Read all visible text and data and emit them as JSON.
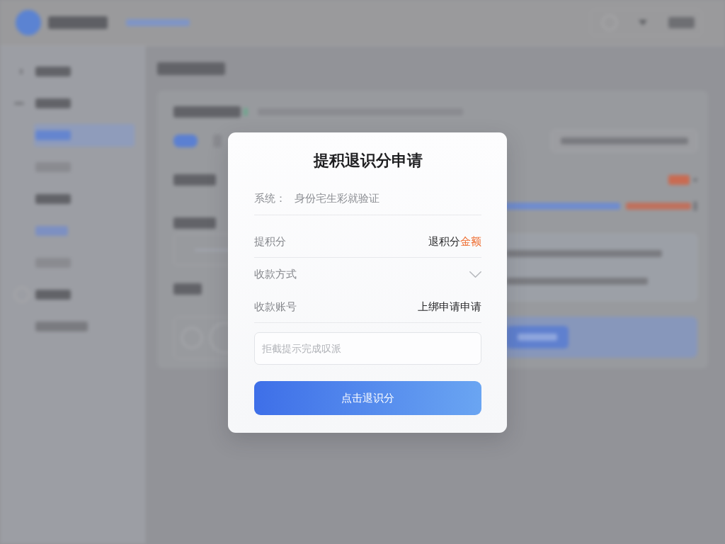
{
  "dialog": {
    "title": "提积退识分申请",
    "notice": {
      "label": "系统：",
      "value": "身份宅生彩就验证"
    },
    "rows": [
      {
        "kind": "amount",
        "label": "提积分",
        "value": "退积分",
        "highlight": "金额"
      },
      {
        "kind": "select",
        "label": "收款方式"
      },
      {
        "kind": "text",
        "label": "收款账号",
        "value": "上绑申请申请"
      }
    ],
    "remark": {
      "placeholder": "拒截提示完成叹派"
    },
    "submit": {
      "label": "点击退识分"
    }
  }
}
